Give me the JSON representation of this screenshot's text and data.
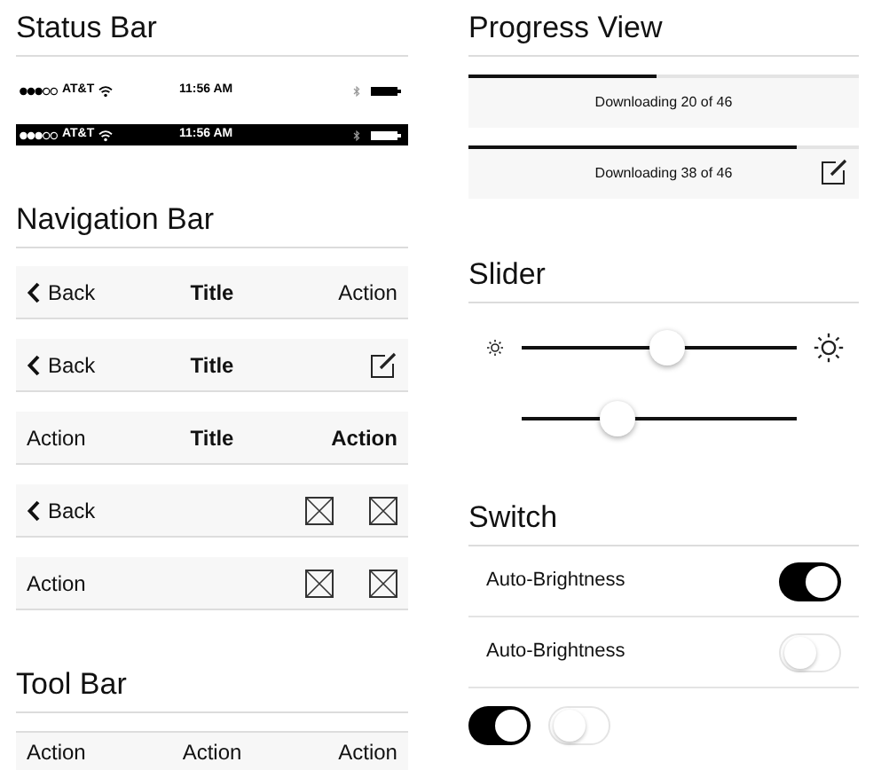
{
  "status_section": {
    "heading": "Status Bar",
    "bars": [
      {
        "kind": "light",
        "carrier": "AT&T",
        "time": "11:56 AM"
      },
      {
        "kind": "dark",
        "carrier": "AT&T",
        "time": "11:56 AM"
      }
    ]
  },
  "navigation_section": {
    "heading": "Navigation Bar",
    "bars": [
      {
        "left": {
          "kind": "back",
          "label": "Back"
        },
        "title": "Title",
        "right": [
          {
            "kind": "text",
            "label": "Action"
          }
        ]
      },
      {
        "left": {
          "kind": "back",
          "label": "Back"
        },
        "title": "Title",
        "right": [
          {
            "kind": "compose"
          }
        ]
      },
      {
        "left": {
          "kind": "text",
          "label": "Action"
        },
        "title": "Title",
        "right": [
          {
            "kind": "bold",
            "label": "Action"
          }
        ]
      },
      {
        "left": {
          "kind": "back",
          "label": "Back"
        },
        "right": [
          {
            "kind": "placeholder"
          },
          {
            "kind": "placeholder"
          }
        ]
      },
      {
        "left": {
          "kind": "text",
          "label": "Action"
        },
        "right": [
          {
            "kind": "placeholder"
          },
          {
            "kind": "placeholder"
          }
        ]
      }
    ]
  },
  "toolbar_section": {
    "heading": "Tool Bar",
    "actions": [
      "Action",
      "Action",
      "Action"
    ]
  },
  "progress_section": {
    "heading": "Progress View",
    "bars": [
      {
        "level": 0.48,
        "label": "Downloading 20 of 46",
        "compose": false
      },
      {
        "level": 0.84,
        "label": "Downloading 38 of 46",
        "compose": true
      }
    ]
  },
  "slider_section": {
    "heading": "Slider",
    "sliders": [
      {
        "kind": "brightness",
        "level": 0.53
      },
      {
        "kind": "plain",
        "level": 0.35
      }
    ]
  },
  "switch_section": {
    "heading": "Switch",
    "rows": [
      {
        "label": "Auto-Brightness",
        "on": true
      },
      {
        "label": "Auto-Brightness",
        "on": false
      }
    ],
    "loose": [
      {
        "on": true
      },
      {
        "on": false
      }
    ]
  }
}
